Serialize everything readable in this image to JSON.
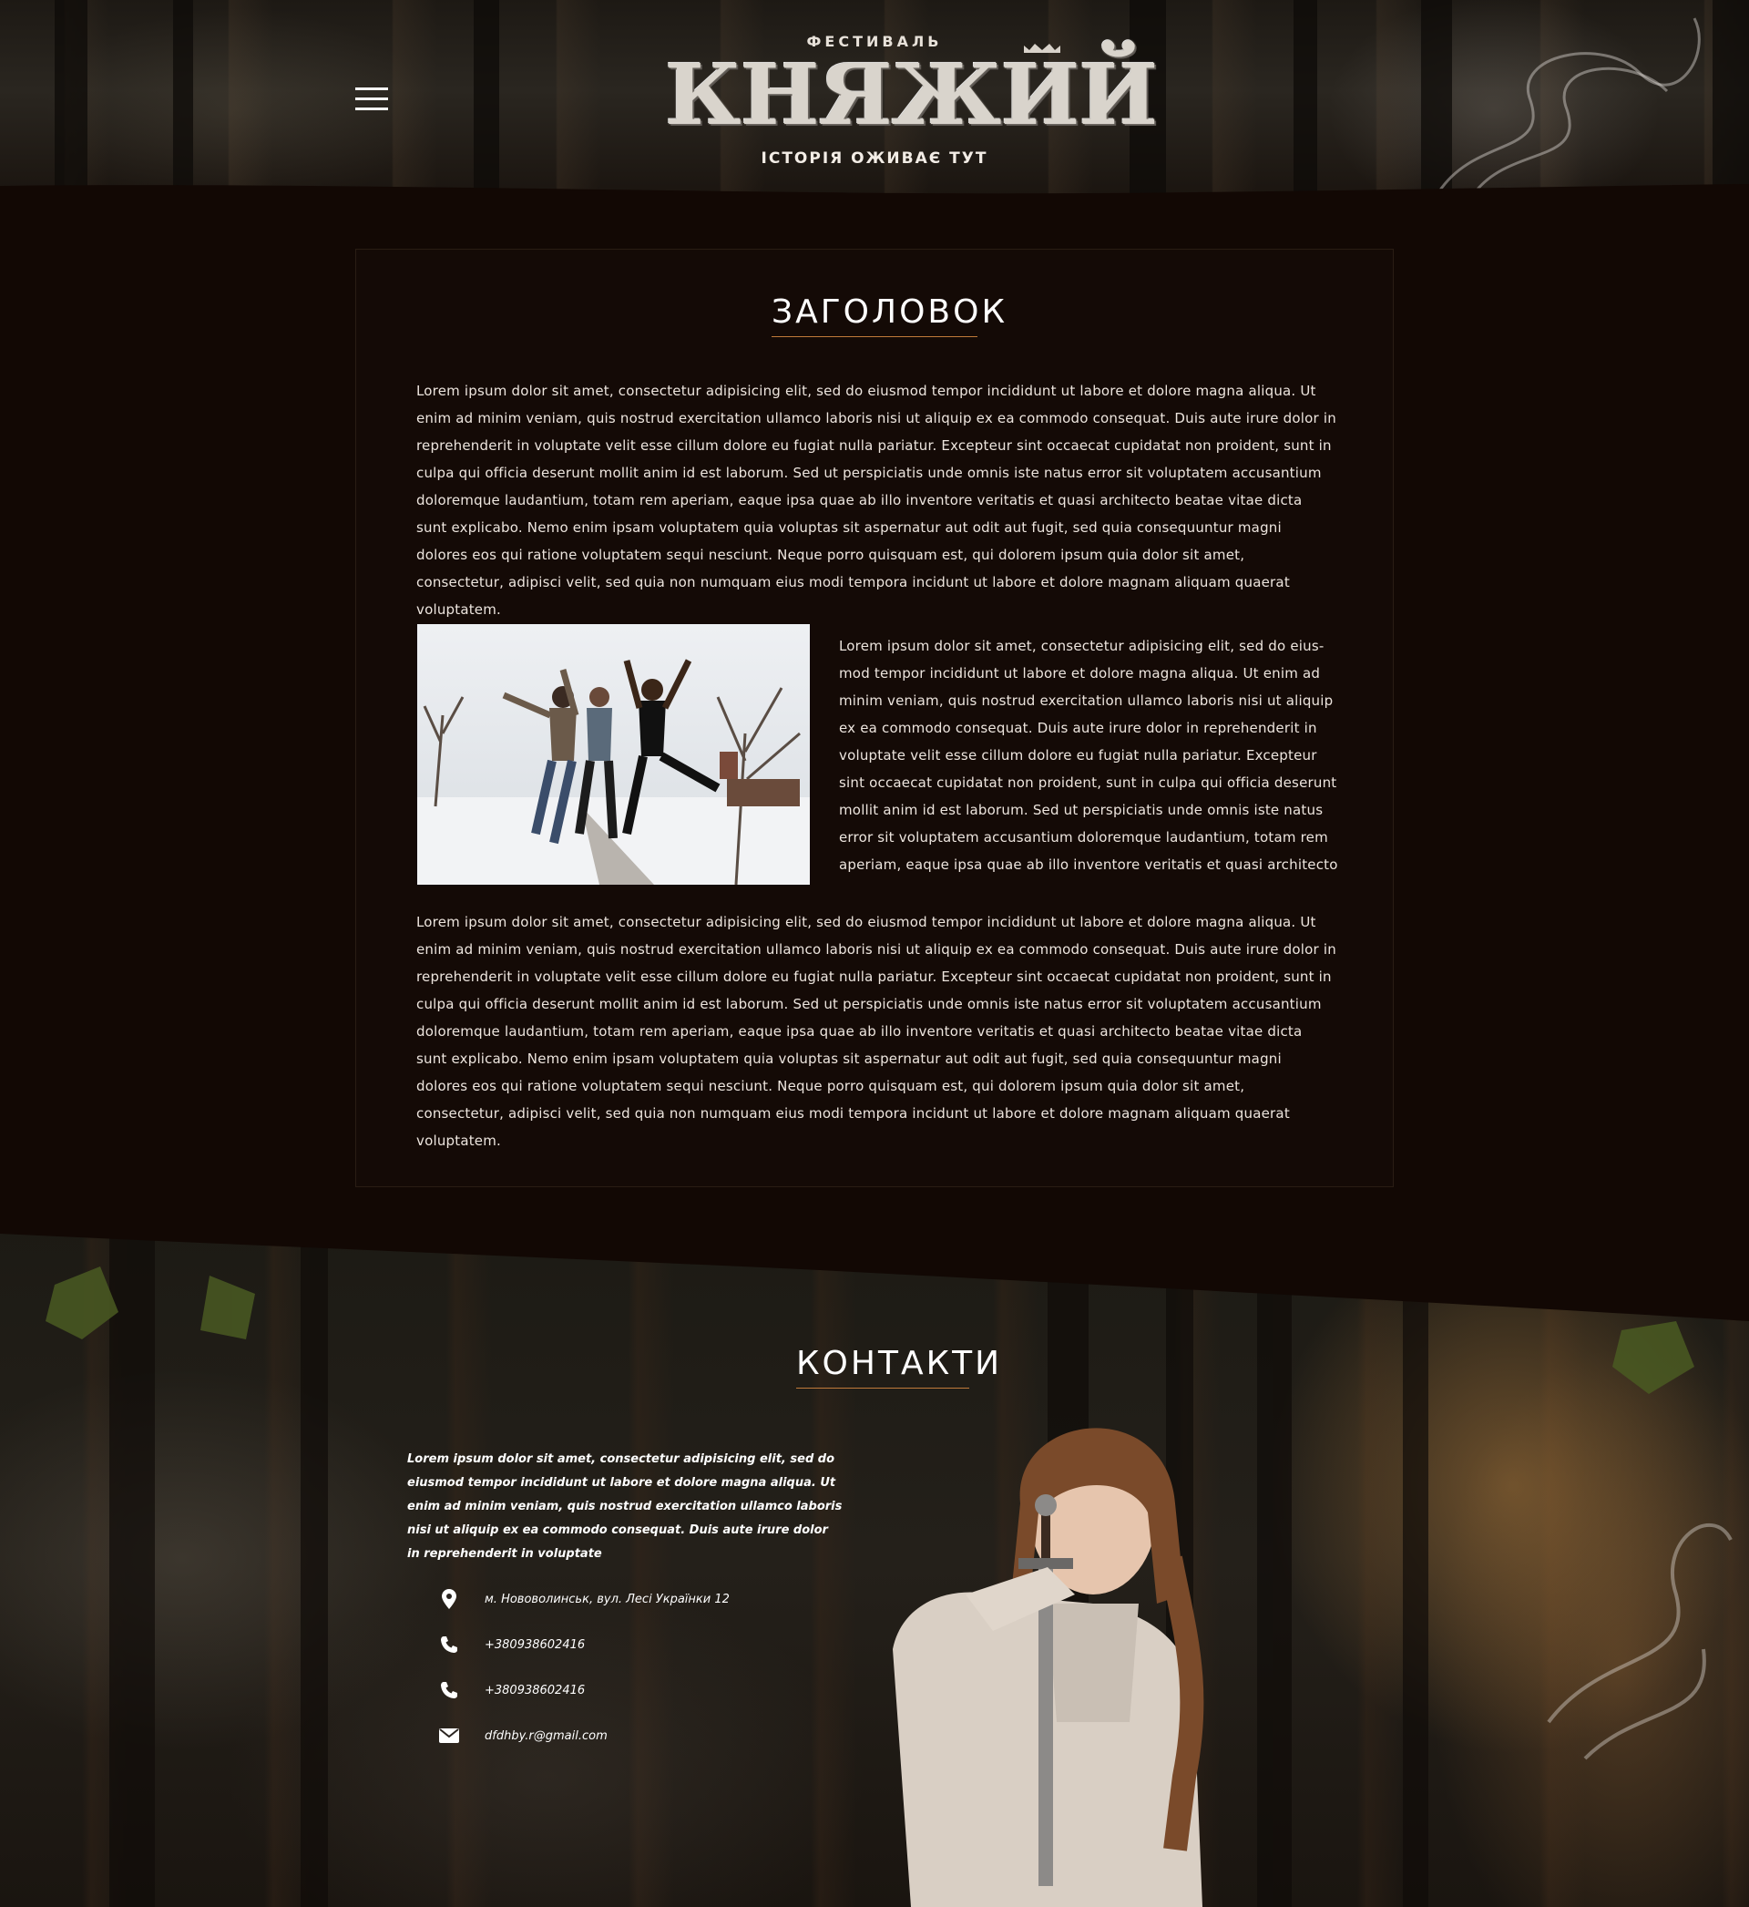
{
  "header": {
    "logo_top": "ФЕСТИВАЛЬ",
    "logo_main": "КНЯЖИЙ",
    "logo_sub": "ІСТОРІЯ ОЖИВАЄ ТУТ",
    "menu_icon": "hamburger-menu-icon"
  },
  "article": {
    "title": "ЗАГОЛОВОК",
    "paragraph_1": "Lorem ipsum dolor sit amet, consectetur adipisicing elit, sed do eiusmod tempor incididunt ut labore et dolore magna aliqua. Ut enim ad minim veniam, quis nostrud exercitation ullamco laboris nisi ut aliquip ex ea commodo consequat. Duis aute irure dolor in reprehenderit in voluptate velit esse cillum dolore eu fugiat nulla pariatur. Excepteur sint occaecat cupidatat non proident, sunt in culpa qui officia deserunt mollit anim id est laborum. Sed ut perspiciatis unde omnis iste natus error sit voluptatem accusantium doloremque laudantium, totam rem aperiam, eaque ipsa quae ab illo inventore veritatis et quasi architecto beatae vitae dicta sunt explicabo. Nemo enim ipsam voluptatem quia voluptas sit aspernatur aut odit aut fugit, sed quia consequuntur magni dolores eos qui ratione voluptatem sequi nesciunt. Neque porro quisquam est, qui dolorem ipsum quia dolor sit amet, consectetur, adipisci velit, sed quia non numquam eius modi tempora incidunt ut labore et dolore magnam aliquam quaerat voluptatem.",
    "paragraph_2": "Lorem ipsum dolor sit amet, consectetur adipisicing elit, sed do eius- mod tempor incididunt ut labore et dolore magna aliqua. Ut enim ad minim veniam, quis nostrud exercitation ullamco laboris nisi ut aliquip ex ea commodo consequat. Duis aute irure dolor in reprehenderit in voluptate velit esse cillum dolore eu fugiat nulla pariatur. Excepteur sint occaecat cupidatat non proident, sunt in culpa qui officia deserunt mollit anim id est laborum. Sed ut perspiciatis unde omnis iste natus error sit voluptatem accusantium doloremque laudantium, totam rem aperiam, eaque ipsa quae ab illo inventore veritatis et quasi architecto",
    "paragraph_3": "Lorem ipsum dolor sit amet, consectetur adipisicing elit, sed do eiusmod tempor incididunt ut labore et dolore magna aliqua. Ut enim ad minim veniam, quis nostrud exercitation ullamco laboris nisi ut aliquip ex ea commodo consequat. Duis aute irure dolor in reprehenderit in voluptate velit esse cillum dolore eu fugiat nulla pariatur. Excepteur sint occaecat cupidatat non proident, sunt in culpa qui officia deserunt mollit anim id est laborum. Sed ut perspiciatis unde omnis iste natus error sit voluptatem accusantium doloremque laudantium, totam rem aperiam, eaque ipsa quae ab illo inventore veritatis et quasi architecto beatae vitae dicta sunt explicabo. Nemo enim ipsam voluptatem quia voluptas sit aspernatur aut odit aut fugit, sed quia consequuntur magni dolores eos qui ratione voluptatem sequi nesciunt. Neque porro quisquam est, qui dolorem ipsum quia dolor sit amet, consectetur, adipisci velit, sed quia non numquam eius modi tempora incidunt ut labore et dolore magnam aliquam quaerat voluptatem."
  },
  "contacts": {
    "title": "КОНТАКТИ",
    "lead": "Lorem ipsum dolor sit amet, consectetur adipisicing elit, sed do eiusmod tempor incididunt ut labore et dolore magna aliqua. Ut enim ad minim veniam, quis nostrud exercitation ullamco laboris nisi ut aliquip ex ea commodo consequat. Duis aute irure dolor in reprehenderit in voluptate",
    "items": [
      {
        "icon": "location-pin-icon",
        "text": "м. Нововолинськ, вул. Лесі Українки 12"
      },
      {
        "icon": "phone-icon",
        "text": "+380938602416"
      },
      {
        "icon": "phone-icon",
        "text": "+380938602416"
      },
      {
        "icon": "envelope-icon",
        "text": "dfdhby.r@gmail.com"
      }
    ]
  },
  "colors": {
    "background": "#120804",
    "title_underline": "#c07a3a",
    "text": "#ede5de"
  }
}
